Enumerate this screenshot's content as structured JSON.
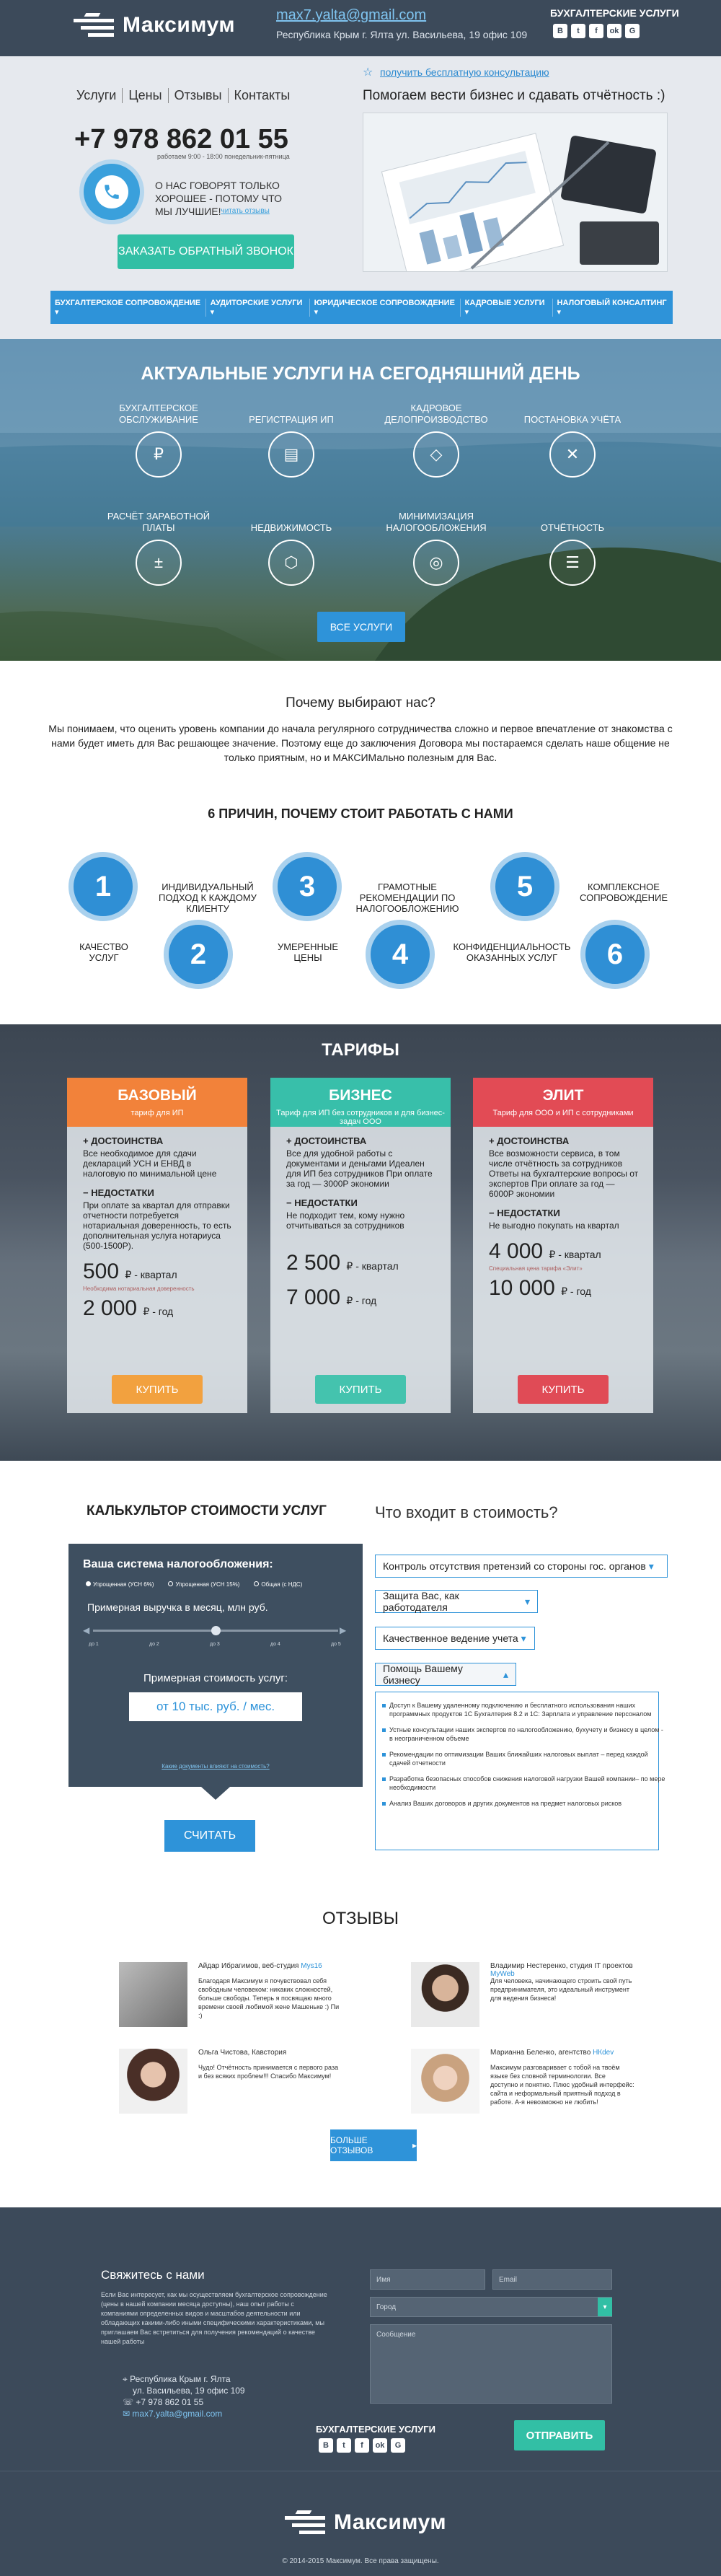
{
  "header": {
    "logo": "Максимум",
    "email": "max7.yalta@gmail.com",
    "address": "Республика Крым  г. Ялта ул. Васильева, 19  офис 109",
    "social_title": "БУХГАЛТЕРСКИЕ УСЛУГИ",
    "social": [
      "В",
      "t",
      "f",
      "ok",
      "G"
    ]
  },
  "hero": {
    "nav": [
      "Услуги",
      "Цены",
      "Отзывы",
      "Контакты"
    ],
    "phone": "+7 978 862 01 55",
    "hours": "работаем 9:00 - 18:00 понедельник-пятница",
    "note": "О НАС  ГОВОРЯТ ТОЛЬКО ХОРОШЕЕ - ПОТОМУ ЧТО МЫ ЛУЧШИЕ!",
    "reviews_link": "читать отзывы",
    "callback": "ЗАКАЗАТЬ ОБРАТНЫЙ ЗВОНОК",
    "consult": "получить бесплатную консультацию",
    "tagline": "Помогаем вести бизнес и сдавать отчётность :)",
    "menu": [
      "БУХГАЛТЕРСКОЕ СОПРОВОЖДЕНИЕ",
      "АУДИТОРСКИЕ  УСЛУГИ",
      "ЮРИДИЧЕСКОЕ СОПРОВОЖДЕНИЕ",
      "КАДРОВЫЕ УСЛУГИ",
      "НАЛОГОВЫЙ КОНСАЛТИНГ"
    ]
  },
  "services": {
    "title": "АКТУАЛЬНЫЕ УСЛУГИ НА СЕГОДНЯШНИЙ ДЕНЬ",
    "items": [
      {
        "label": "БУХГАЛТЕРСКОЕ ОБСЛУЖИВАНИЕ",
        "icon": "money-icon"
      },
      {
        "label": "РЕГИСТРАЦИЯ ИП",
        "icon": "id-card-icon"
      },
      {
        "label": "КАДРОВОЕ ДЕЛОПРОИЗВОДСТВО",
        "icon": "tag-icon"
      },
      {
        "label": "ПОСТАНОВКА УЧЁТА",
        "icon": "tools-icon"
      },
      {
        "label": "РАСЧЁТ ЗАРАБОТНОЙ ПЛАТЫ",
        "icon": "calculator-icon"
      },
      {
        "label": "НЕДВИЖИМОСТЬ",
        "icon": "box-icon"
      },
      {
        "label": "МИНИМИЗАЦИЯ НАЛОГООБЛОЖЕНИЯ",
        "icon": "coins-icon"
      },
      {
        "label": "ОТЧЁТНОСТЬ",
        "icon": "clipboard-icon"
      }
    ],
    "button": "ВСЕ УСЛУГИ"
  },
  "why": {
    "question": "Почему выбирают нас?",
    "text": "Мы понимаем, что оценить уровень компании до начала регулярного сотрудничества сложно и первое впечатление от знакомства с нами будет иметь для Вас решающее значение. Поэтому еще до заключения Договора мы постараемся сделать наше общение не только приятным, но и МАКСИМально полезным для Вас.",
    "reasons_title": "6 ПРИЧИН, ПОЧЕМУ СТОИТ РАБОТАТЬ С НАМИ",
    "reasons": [
      {
        "num": "1",
        "text": "КАЧЕСТВО УСЛУГ"
      },
      {
        "num": "2",
        "text": "ИНДИВИДУАЛЬНЫЙ ПОДХОД К КАЖДОМУ КЛИЕНТУ"
      },
      {
        "num": "3",
        "text": "УМЕРЕННЫЕ ЦЕНЫ"
      },
      {
        "num": "4",
        "text": "ГРАМОТНЫЕ РЕКОМЕНДАЦИИ ПО НАЛОГООБЛОЖЕНИЮ"
      },
      {
        "num": "5",
        "text": "КОНФИДЕНЦИАЛЬНОСТЬ ОКАЗАННЫХ УСЛУГ"
      },
      {
        "num": "6",
        "text": "КОМПЛЕКСНОЕ СОПРОВОЖДЕНИЕ"
      }
    ]
  },
  "tariffs": {
    "title": "ТАРИФЫ",
    "cards": [
      {
        "name": "БАЗОВЫЙ",
        "sub": "тариф для ИП",
        "color": "#f2823a",
        "adv_title": "ДОСТОИНСТВА",
        "adv": "Все необходимое для сдачи деклараций УСН и ЕНВД в налоговую по минимальной цене",
        "dis_title": "НЕДОСТАТКИ",
        "dis": "При оплате за квартал для отправки отчетности потребуется нотариальная доверенность, то есть дополнительная услуга нотариуса (500-1500Р).",
        "price1": "500",
        "unit1": "₽ - квартал",
        "note": "Необходима нотариальная доверенность",
        "price2": "2 000",
        "unit2": "₽ - год",
        "button": "КУПИТЬ",
        "btn_color": "#f2a13f"
      },
      {
        "name": "БИЗНЕС",
        "sub": "Тариф для ИП без сотрудников и для бизнес- задач ООО",
        "color": "#38bfaa",
        "adv_title": "ДОСТОИНСТВА",
        "adv": "Все для удобной работы с документами и деньгами Идеален для ИП без сотрудников При оплате за год — 3000Р экономии",
        "dis_title": "НЕДОСТАТКИ",
        "dis": "Не подходит тем, кому нужно отчитываться за сотрудников",
        "price1": "2 500",
        "unit1": "₽ - квартал",
        "note": "",
        "price2": "7 000",
        "unit2": "₽ - год",
        "button": "КУПИТЬ",
        "btn_color": "#44c3ae"
      },
      {
        "name": "ЭЛИТ",
        "sub": "Тариф для ООО и ИП с сотрудниками",
        "color": "#e24b55",
        "adv_title": "ДОСТОИНСТВА",
        "adv": "Все возможности сервиса, в том числе отчётность за сотрудников Ответы на бухгалтерские вопросы от экспертов При оплате за год — 6000Р экономии",
        "dis_title": "НЕДОСТАТКИ",
        "dis": "Не выгодно покупать на квартал",
        "price1": "4 000",
        "unit1": "₽ - квартал",
        "note": "Специальная цена тарифа «Элит»",
        "price2": "10 000",
        "unit2": "₽ - год",
        "button": "КУПИТЬ",
        "btn_color": "#e04b56"
      }
    ]
  },
  "calculator": {
    "title": "КАЛЬКУЛЬТОР СТОИМОСТИ УСЛУГ",
    "tax_label": "Ваша система налогообложения:",
    "tax_options": [
      "Упрощенная (УСН 6%)",
      "Упрощенная (УСН 15%)",
      "Общая (с НДС)"
    ],
    "revenue_label": "Примерная выручка в месяц, млн руб.",
    "ticks": [
      "до 1",
      "до 2",
      "до 3",
      "до 4",
      "до 5"
    ],
    "slider_value": 0.5,
    "cost_label": "Примерная стоимость услуг:",
    "cost_value": "от 10 тыс. руб. / мес.",
    "hint": "Какие документы влияют на стоимость?",
    "button": "СЧИТАТЬ"
  },
  "included": {
    "title": "Что входит в стоимость?",
    "items": [
      "Контроль отсутствия претензий со стороны гос. органов",
      "Защита Вас, как работодателя",
      "Качественное ведение учета",
      "Помощь Вашему бизнесу"
    ],
    "details": [
      "Доступ к Вашему удаленному подключению и бесплатного использования наших программных продуктов 1С Бухгалтерия 8.2 и 1С: Зарплата и управление персоналом",
      "Устные консультации наших экспертов по налогообложению, бухучету и бизнесу в целом - в неограниченном объеме",
      "Рекомендации по оптимизации Ваших ближайших налоговых выплат – перед каждой сдачей отчетности",
      "Разработка безопасных способов снижения налоговой нагрузки Вашей компании– по мере необходимости",
      "Анализ Ваших договоров и других документов на предмет налоговых рисков"
    ]
  },
  "reviews": {
    "title": "ОТЗЫВЫ",
    "items": [
      {
        "name": "Айдар Ибрагимов, веб-студия",
        "company": "Mys16",
        "text": "Благодаря Максимум я почувствовал себя свободным человеком: никаких сложностей, больше свободы. Теперь я посвящаю много времени своей любимой жене Машеньке :) Пи :)"
      },
      {
        "name": "Владимир Нестеренко, студия IT проектов",
        "company": "MyWeb",
        "text": "Для человека, начинающего строить свой путь предпринимателя, это идеальный инструмент для ведения бизнеса!"
      },
      {
        "name": "Ольга Чистова, Кавстория",
        "company": "",
        "text": "Чудо! Отчётность принимается с первого раза и без всяких проблем!!! Спасибо Максимум!"
      },
      {
        "name": "Марианна Беленко, агентство",
        "company": "НКdev",
        "text": "Максимум разговаривает с тобой на твоём языке без словной терминологии. Все доступно и понятно. Плюс удобный интерфейс: сайта и неформальный приятный подход в работе. А-я невозможно не любить!"
      }
    ],
    "more": "БОЛЬШЕ ОТЗЫВОВ"
  },
  "footer": {
    "contact_title": "Свяжитесь с нами",
    "contact_text": "Если Вас интересует, как мы осуществляем бухгалтерское сопровождение (цены в нашей компании месяца доступны), наш опыт работы с компаниями определенных видов и масштабов деятельности или обладающих какими-либо иными специфическими характеристиками, мы приглашаем Вас встретиться для получения рекомендаций о качестве нашей работы",
    "address1": "Республика Крым  г. Ялта",
    "address2": "ул. Васильева, 19  офис 109",
    "phone": "+7 978 862 01 55",
    "email": "max7.yalta@gmail.com",
    "name_ph": "Имя",
    "email_ph": "Email",
    "city_ph": "Город",
    "msg_ph": "Сообщение",
    "send": "ОТПРАВИТЬ",
    "social_title": "БУХГАЛТЕРСКИЕ УСЛУГИ",
    "logo": "Максимум",
    "copyright": "© 2014-2015 Максимум. Все права защищены."
  }
}
